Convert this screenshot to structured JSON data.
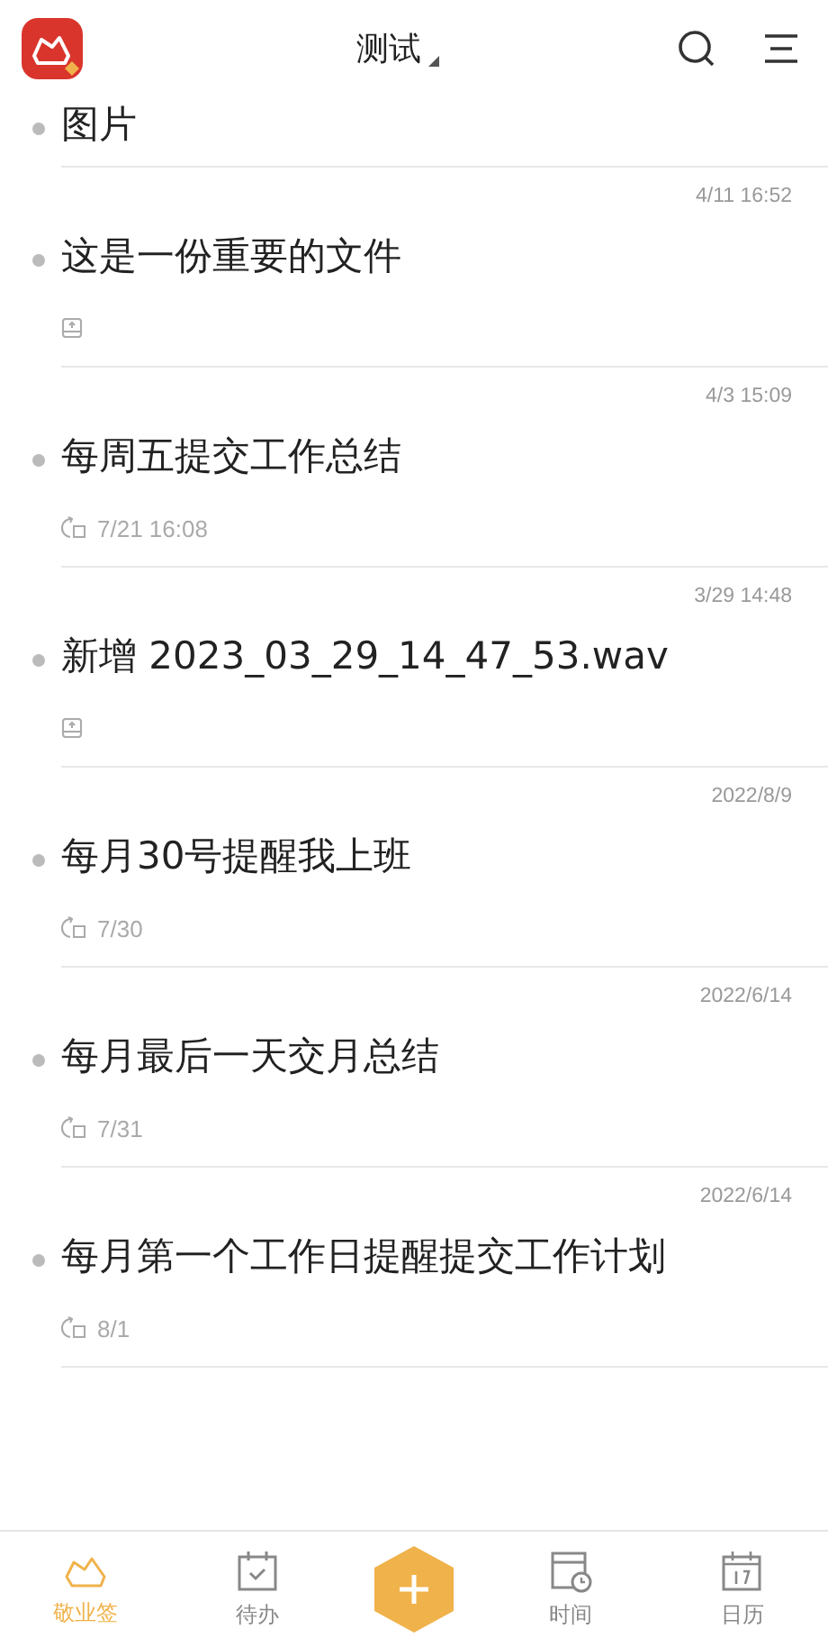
{
  "header": {
    "title": "测试"
  },
  "notes": [
    {
      "title": "图片"
    },
    {
      "date": "4/11 16:52",
      "title": "这是一份重要的文件",
      "meta": {
        "kind": "inbox"
      }
    },
    {
      "date": "4/3 15:09",
      "title": "每周五提交工作总结",
      "meta": {
        "kind": "repeat",
        "text": "7/21 16:08"
      }
    },
    {
      "date": "3/29 14:48",
      "title": "新增 2023_03_29_14_47_53.wav",
      "meta": {
        "kind": "inbox"
      }
    },
    {
      "date": "2022/8/9",
      "title": "每月30号提醒我上班",
      "meta": {
        "kind": "repeat",
        "text": "7/30"
      }
    },
    {
      "date": "2022/6/14",
      "title": "每月最后一天交月总结",
      "meta": {
        "kind": "repeat",
        "text": "7/31"
      }
    },
    {
      "date": "2022/6/14",
      "title": "每月第一个工作日提醒提交工作计划",
      "meta": {
        "kind": "repeat",
        "text": "8/1"
      }
    }
  ],
  "tabs": [
    {
      "kind": "note",
      "label": "敬业签",
      "selected": true
    },
    {
      "kind": "todo",
      "label": "待办",
      "selected": false
    },
    {
      "kind": "add"
    },
    {
      "kind": "time",
      "label": "时间",
      "selected": false
    },
    {
      "kind": "calendar",
      "label": "日历",
      "selected": false
    }
  ]
}
